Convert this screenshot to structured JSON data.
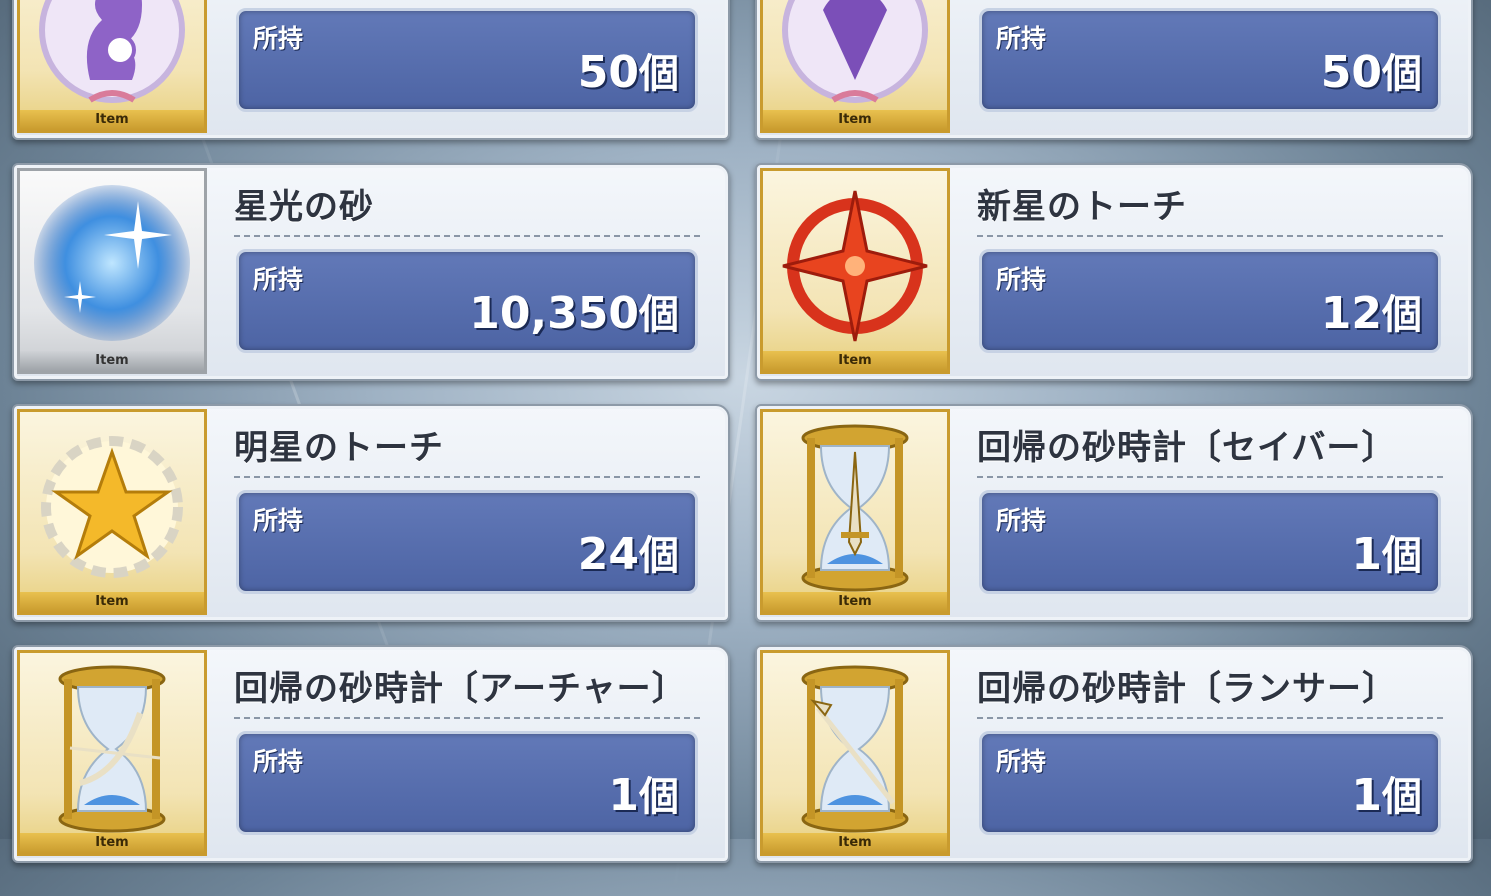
{
  "item_cards": [
    {
      "name": "",
      "held_label": "所持",
      "count": "50",
      "unit": "個",
      "type_label": "Item",
      "icon": "purple-horse-emblem-icon",
      "frame": "gold"
    },
    {
      "name": "",
      "held_label": "所持",
      "count": "50",
      "unit": "個",
      "type_label": "Item",
      "icon": "purple-dragon-emblem-icon",
      "frame": "gold"
    },
    {
      "name": "星光の砂",
      "held_label": "所持",
      "count": "10,350",
      "unit": "個",
      "type_label": "Item",
      "icon": "starlight-sand-icon",
      "frame": "silver"
    },
    {
      "name": "新星のトーチ",
      "held_label": "所持",
      "count": "12",
      "unit": "個",
      "type_label": "Item",
      "icon": "nova-torch-icon",
      "frame": "gold"
    },
    {
      "name": "明星のトーチ",
      "held_label": "所持",
      "count": "24",
      "unit": "個",
      "type_label": "Item",
      "icon": "morning-star-torch-icon",
      "frame": "gold"
    },
    {
      "name": "回帰の砂時計〔セイバー〕",
      "held_label": "所持",
      "count": "1",
      "unit": "個",
      "type_label": "Item",
      "icon": "hourglass-sword-icon",
      "frame": "gold"
    },
    {
      "name": "回帰の砂時計〔アーチャー〕",
      "held_label": "所持",
      "count": "1",
      "unit": "個",
      "type_label": "Item",
      "icon": "hourglass-bow-icon",
      "frame": "gold"
    },
    {
      "name": "回帰の砂時計〔ランサー〕",
      "held_label": "所持",
      "count": "1",
      "unit": "個",
      "type_label": "Item",
      "icon": "hourglass-spear-icon",
      "frame": "gold"
    }
  ]
}
